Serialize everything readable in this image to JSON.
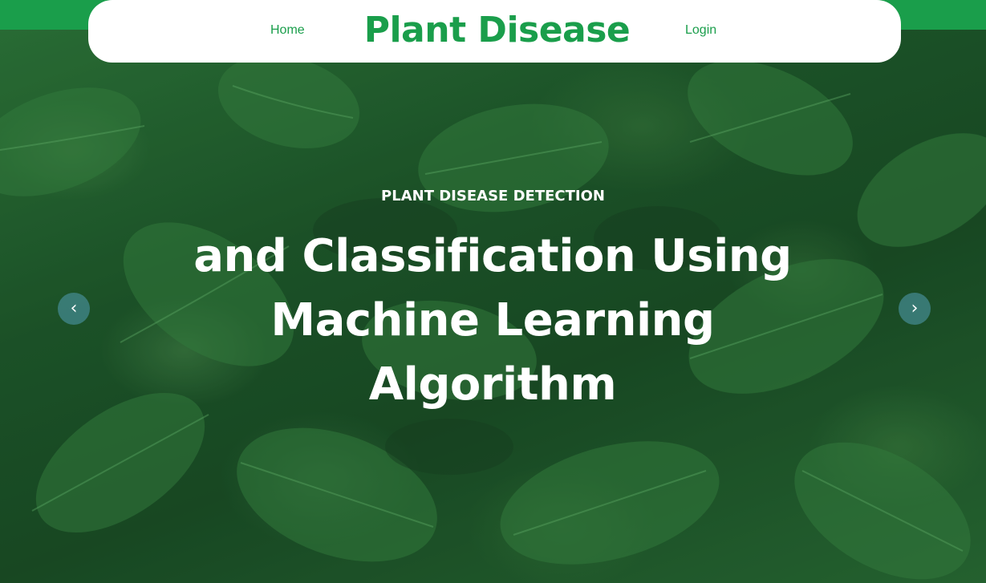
{
  "navbar": {
    "home_label": "Home",
    "brand": "Plant Disease",
    "login_label": "Login"
  },
  "hero": {
    "subtitle": "PLANT DISEASE DETECTION",
    "headline": "and Classification Using Machine Learning Algorithm",
    "prev_icon": "chevron-left-icon",
    "next_icon": "chevron-right-icon",
    "prev_glyph": "‹",
    "next_glyph": "›"
  },
  "colors": {
    "brand_green": "#1a9e4b",
    "navbar_bg": "#ffffff",
    "text_on_hero": "#ffffff",
    "carousel_button": "#468c96"
  }
}
